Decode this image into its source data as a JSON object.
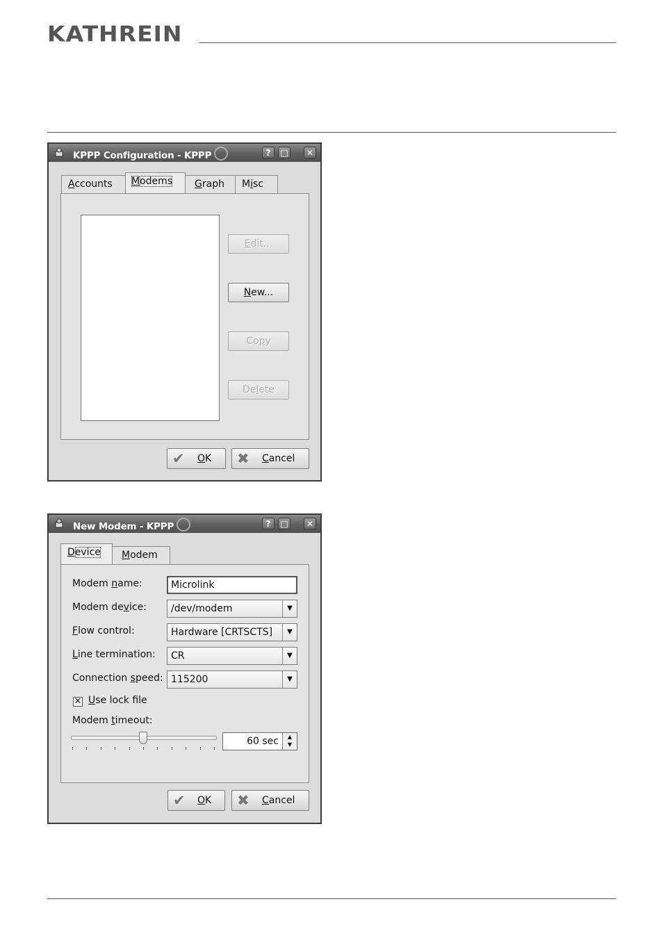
{
  "header": {
    "brand": "KATHREIN"
  },
  "kppp_config": {
    "title": "KPPP Configuration - KPPP",
    "titlebar_buttons": [
      "?",
      "□",
      "✕"
    ],
    "tabs": [
      {
        "pre": "",
        "u": "A",
        "post": "ccounts"
      },
      {
        "pre": "",
        "u": "M",
        "post": "odems"
      },
      {
        "pre": "",
        "u": "G",
        "post": "raph"
      },
      {
        "pre": "M",
        "u": "i",
        "post": "sc"
      }
    ],
    "selected_tab": "Modems",
    "buttons": {
      "edit": {
        "pre": "",
        "u": "E",
        "post": "dit..."
      },
      "new": {
        "pre": "",
        "u": "N",
        "post": "ew..."
      },
      "copy": {
        "pre": "Co",
        "u": "p",
        "post": "y"
      },
      "delete": {
        "pre": "De",
        "u": "l",
        "post": "ete"
      }
    },
    "ok": {
      "pre": "",
      "u": "O",
      "post": "K"
    },
    "cancel": {
      "pre": "",
      "u": "C",
      "post": "ancel"
    }
  },
  "new_modem": {
    "title": "New Modem - KPPP",
    "titlebar_buttons": [
      "?",
      "□",
      "✕"
    ],
    "tabs": [
      {
        "pre": "",
        "u": "D",
        "post": "evice"
      },
      {
        "pre": "",
        "u": "M",
        "post": "odem"
      }
    ],
    "selected_tab": "Device",
    "fields": {
      "modem_name": {
        "label_pre": "Modem ",
        "label_u": "n",
        "label_post": "ame:",
        "value": "Microlink"
      },
      "modem_device": {
        "label_pre": "Modem de",
        "label_u": "v",
        "label_post": "ice:",
        "value": "/dev/modem"
      },
      "flow_control": {
        "label_pre": "",
        "label_u": "F",
        "label_post": "low control:",
        "value": "Hardware [CRTSCTS]"
      },
      "line_termination": {
        "label_pre": "",
        "label_u": "L",
        "label_post": "ine termination:",
        "value": "CR"
      },
      "connection_speed": {
        "label_pre": "Connection ",
        "label_u": "s",
        "label_post": "peed:",
        "value": "115200"
      }
    },
    "use_lock_file": {
      "label_pre": "",
      "label_u": "U",
      "label_post": "se lock file",
      "checked": true,
      "mark": "✕"
    },
    "modem_timeout": {
      "label_pre": "Modem ",
      "label_u": "t",
      "label_post": "imeout:",
      "value": "60 sec",
      "slider_fraction": 0.5
    },
    "ok": {
      "pre": "",
      "u": "O",
      "post": "K"
    },
    "cancel": {
      "pre": "",
      "u": "C",
      "post": "ancel"
    }
  }
}
